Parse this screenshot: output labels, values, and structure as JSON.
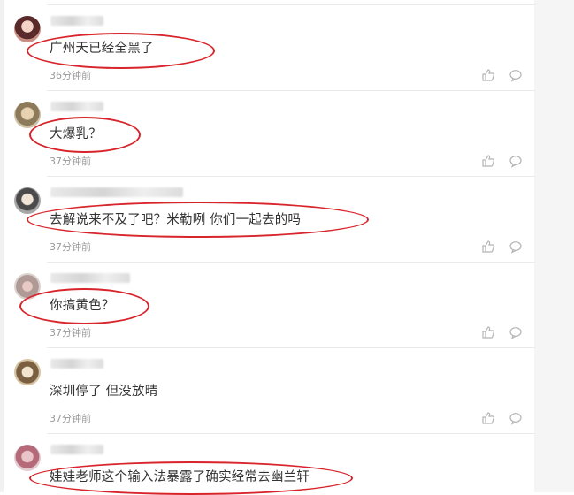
{
  "comments": [
    {
      "text": "广州天已经全黑了",
      "time": "36分钟前"
    },
    {
      "text": "大爆乳？",
      "time": "37分钟前"
    },
    {
      "text": "去解说来不及了吧？米勒咧 你们一起去的吗",
      "time": "37分钟前"
    },
    {
      "text": "你搞黄色？",
      "time": "37分钟前"
    },
    {
      "text": "深圳停了 但没放晴",
      "time": "37分钟前"
    },
    {
      "text": "娃娃老师这个输入法暴露了确实经常去幽兰轩",
      "time": ""
    }
  ],
  "icons": {
    "like": "thumbs-up-icon",
    "reply": "comment-bubble-icon"
  },
  "colors": {
    "highlight": "#d8242b",
    "text": "#333333",
    "time": "#999999",
    "icon": "#b5b5b5"
  }
}
